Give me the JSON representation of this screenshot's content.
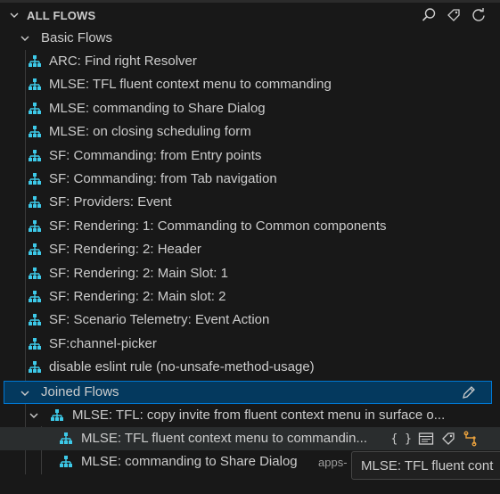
{
  "section": {
    "title": "ALL FLOWS",
    "actions": [
      "search-icon",
      "tag-icon",
      "refresh-icon"
    ]
  },
  "basic_group": {
    "label": "Basic Flows",
    "items": [
      "ARC: Find right Resolver",
      "MLSE: TFL fluent context menu to commanding",
      "MLSE: commanding to Share Dialog",
      "MLSE: on closing scheduling form",
      "SF: Commanding: from Entry points",
      "SF: Commanding: from Tab navigation",
      "SF: Providers: Event",
      "SF: Rendering: 1: Commanding to Common components",
      "SF: Rendering: 2: Header",
      "SF: Rendering: 2: Main Slot: 1",
      "SF: Rendering: 2: Main slot: 2",
      "SF: Scenario Telemetry: Event Action",
      "SF:channel-picker",
      "disable eslint rule (no-unsafe-method-usage)"
    ]
  },
  "joined_group": {
    "label": "Joined Flows",
    "edit_icon": "pencil-icon",
    "parent": "MLSE: TFL: copy invite from fluent context menu in surface o...",
    "children": [
      {
        "label": "MLSE: TFL fluent context menu to commandin...",
        "actions": [
          "braces-icon",
          "preview-icon",
          "tag-icon",
          "flow-orange-icon"
        ],
        "braces": "{ }"
      },
      {
        "label": "MLSE: commanding to Share Dialog",
        "description": "apps-"
      }
    ]
  },
  "tooltip": "MLSE: TFL fluent cont",
  "colors": {
    "background": "#181818",
    "selection_bg": "#04395e",
    "selection_border": "#0078d4",
    "flow_icon": "#3dc9e8",
    "accent_orange": "#e8a03d"
  }
}
